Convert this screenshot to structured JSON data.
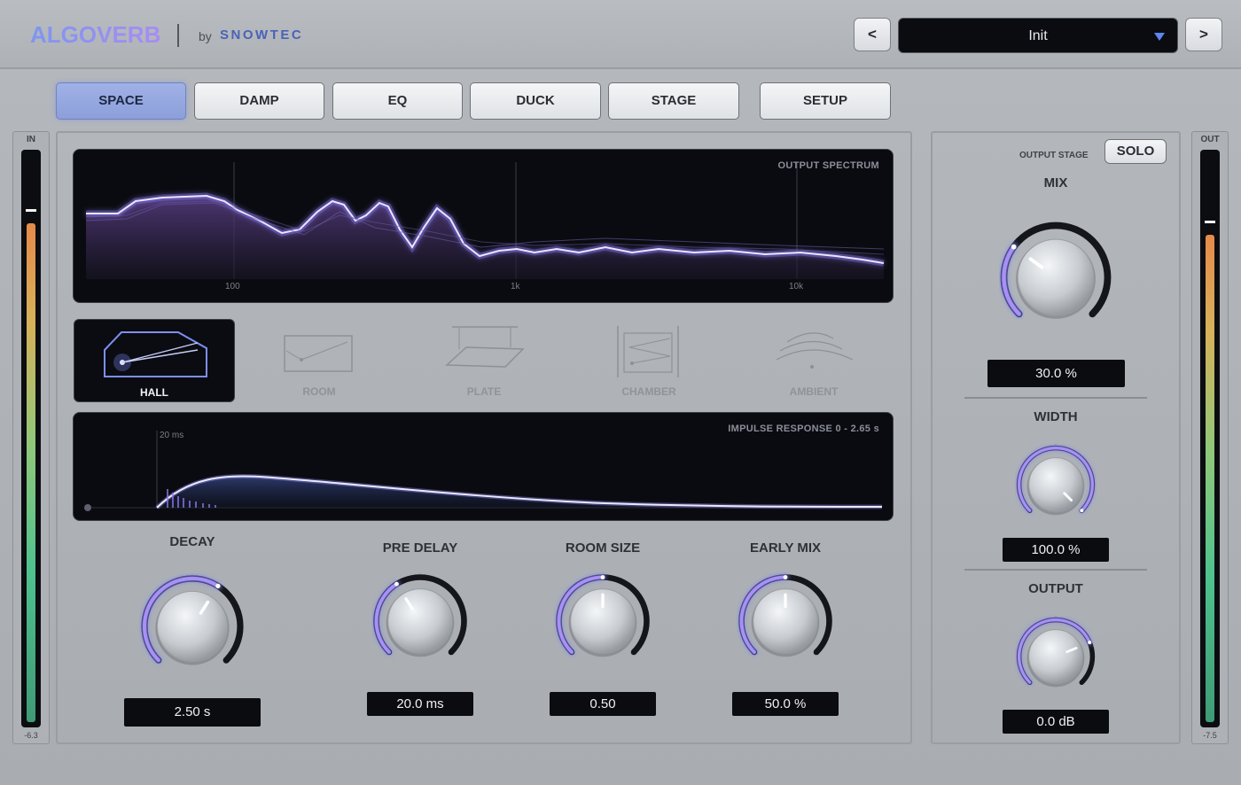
{
  "header": {
    "logo": "ALGOVERB",
    "by": "by",
    "brand": "SNOWTEC",
    "prev_label": "<",
    "next_label": ">",
    "preset": "Init"
  },
  "tabs": [
    {
      "label": "SPACE",
      "active": true
    },
    {
      "label": "DAMP",
      "active": false
    },
    {
      "label": "EQ",
      "active": false
    },
    {
      "label": "DUCK",
      "active": false
    },
    {
      "label": "STAGE",
      "active": false
    },
    {
      "label": "SETUP",
      "active": false
    }
  ],
  "meters": {
    "in": {
      "label": "IN",
      "value": "-6.3",
      "level": 0.88,
      "peak": 0.9
    },
    "out": {
      "label": "OUT",
      "value": "-7.5",
      "level": 0.86,
      "peak": 0.88
    }
  },
  "spectrum": {
    "title": "OUTPUT SPECTRUM",
    "freq_labels": [
      "100",
      "1k",
      "10k"
    ]
  },
  "algorithms": [
    {
      "label": "HALL",
      "active": true
    },
    {
      "label": "ROOM",
      "active": false
    },
    {
      "label": "PLATE",
      "active": false
    },
    {
      "label": "CHAMBER",
      "active": false
    },
    {
      "label": "AMBIENT",
      "active": false
    }
  ],
  "impulse": {
    "title": "IMPULSE RESPONSE  0 - 2.65 s",
    "predelay_label": "20 ms"
  },
  "params": {
    "decay": {
      "label": "DECAY",
      "value": "2.50 s",
      "norm": 0.62
    },
    "predelay": {
      "label": "PRE DELAY",
      "value": "20.0 ms",
      "norm": 0.38
    },
    "roomsize": {
      "label": "ROOM SIZE",
      "value": "0.50",
      "norm": 0.5
    },
    "earlymix": {
      "label": "EARLY MIX",
      "value": "50.0 %",
      "norm": 0.5
    }
  },
  "output_stage": {
    "label": "OUTPUT STAGE",
    "solo_label": "SOLO",
    "mix": {
      "label": "MIX",
      "value": "30.0 %",
      "norm": 0.3
    },
    "width": {
      "label": "WIDTH",
      "value": "100.0 %",
      "norm": 1.0
    },
    "output": {
      "label": "OUTPUT",
      "value": "0.0 dB",
      "norm": 0.75
    }
  },
  "colors": {
    "accent": "#7f86f2",
    "arc": "#a98ff7",
    "display_bg": "#0a0b10"
  }
}
